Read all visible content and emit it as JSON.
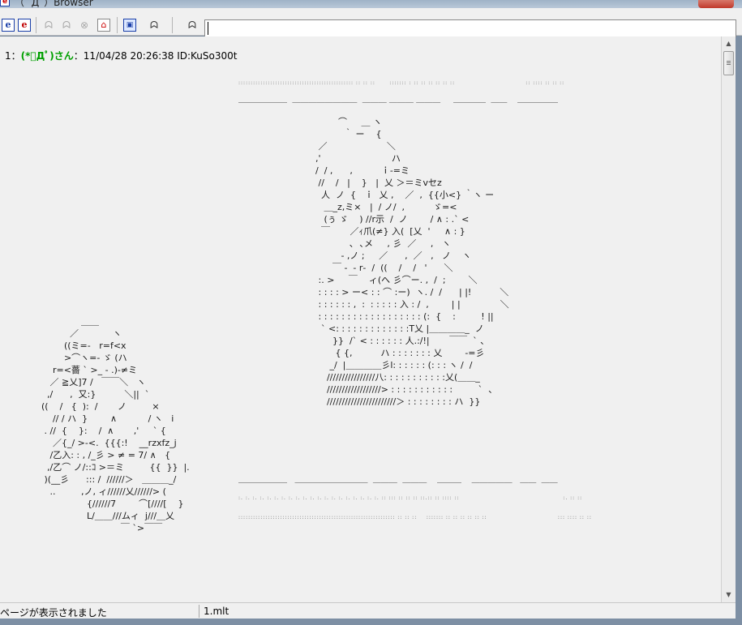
{
  "window": {
    "title": "（ ﾟДﾟ）Browser",
    "title_icon": "e"
  },
  "toolbar": {
    "buttons": [
      {
        "name": "ie-icon-1",
        "glyph": "e"
      },
      {
        "name": "ie-icon-2",
        "glyph": "e"
      },
      {
        "name": "back-disabled-icon",
        "glyph": "ᗣ"
      },
      {
        "name": "forward-disabled-icon",
        "glyph": "ᗣ"
      },
      {
        "name": "stop-disabled-icon",
        "glyph": "⊗"
      },
      {
        "name": "home-icon",
        "glyph": "⌂"
      },
      {
        "name": "window-icon",
        "glyph": "▣"
      },
      {
        "name": "mona-icon",
        "glyph": "ᗣ"
      },
      {
        "name": "settings-mona-icon",
        "glyph": "ᗣ"
      }
    ],
    "address_value": ""
  },
  "post": {
    "number": "1",
    "separator": "：",
    "name": "(*ﾟДﾟ)さん",
    "meta": "：11/04/28 20:26:38 ID:KuSo300t"
  },
  "art": {
    "dots_top_1": "::::::::::::::::::::::::::::::::::::::::::::::: :: :: ::      ::::::: : :: :: :: :: :: ::                              :: :::: :: :: ::",
    "dots_top_2": "＿＿＿＿＿＿  ＿＿＿＿＿＿＿＿  ＿＿＿ ＿＿＿ ＿＿＿     ＿＿＿＿  ＿＿    ＿＿＿＿＿",
    "right_figure": "          ⌒     ＿ ヽ\n            ｀ ー    {\n   ／                     ＼\n  ,'                         ハ\n  /  / ,      ,          ｉ‐=ミ\n   //    /   |    }   |  乂 ＞＝ミvセz\n    人  ノ  {   ｉ  乂 ,    ／  ,  {{小<} ｀ヽ ー\n     ＿_z,ミ×   |  / ノ/  ,          ゞ=<\n     (ぅ ゞ    ) //r示  /  ノ        / ∧ : .` <\n    ￣       ／ｨ爪(≠} 入(  [乂  '     ∧ : }\n              ､  ､メ     , 彡  ／     ,   ヽ\n           - ,ノ ;     ／      ,  ／   ,   ノ    ヽ\n        ￣ -  ‐ r‐  /  ((    /    /   '      ＼\n   :. >     ￣    ィ(へ 彡⌒ー. ,  /  ;        ＼\n   : : : : > ー< : : ⌒ :ー)  ヽ. /  /      | |!          ＼\n   : : : : : : ,  :  : : : : : 入 : /  ,        | |              ＼\n   : : : : : : : : : : : : : : : : : : (:  {    :         ! ||\n    ` <: : : : : : : : : : : : :T乂 |＿＿＿＿_  ノ\n        }}  /` < : : : : : : 人.:/!|       ￣￣  ` 、\n         { {,          ハ : : : : : : : 乂        ‐=彡\n       _/  |＿＿＿＿彡l: : : : : : (: : : ヽ /  /\n      ////////////////八: : : : : : : : : : :乂(＿＿_\n      //////////////////> : : : : : : : : : : :         `  、\n      ///////////////////////＞ : : : : : : : : ハ  }}",
    "left_figure": "                ＿＿\n            ／            ヽ\n          ((ミ=-   r=f<x\n          >⌒ヽ=- ゞ (ハ\n      r=<薔 ` >_ ‐ .)‐≠ミ\n     ／ ≧乂]7 /   ￣￣＼   ヽ\n    ,/      ,  又:}          ＼||  `\n  ((    /   {  ):  /       ノ         ×\n      // / ハ  }        ∧           / ヽ   i\n   . //  {    }:    /  ∧       ,'     ` {\n      ／{_/ >‐<.  {{{:!    __rzxfz_j\n     /乙入: : , /_彡 > ≠ = 7/ ∧   {\n    ,/乙⌒ ノ/::ｺ >＝ミ         {{  }}  |.\n   )(__彡      ::: /  //////＞   ＿＿＿_/\n     ..         ,ノ, ィ//////乂//////> (\n                  {//////7        ⌒[////[    }\n                  L/＿＿///ムィ  j///＿乂\n                              ￣ `>￣￣",
    "dots_bottom_1": "＿＿＿＿＿＿   ＿＿＿＿＿＿＿＿＿  ＿＿＿  ＿＿＿    ＿＿＿    ＿＿＿＿＿   ＿＿  ＿＿",
    "dots_bottom_2": ":. :. :. :. :. :. :. :. :. :. :. :. :. :. :. :. :. :. :. :. :: ::: :: :: :: ::.:: :: :::: ::                                            :. :: ::",
    "dots_bottom_3": ":::::::::::::::::::::::::::::::::::::::::::::::::::::::::::::::: :: :: ::    ::::::: :: :: :: :: :: ::                              ::: :::: :: ::"
  },
  "status": {
    "message": "ページが表示されました",
    "file": "1.mlt"
  },
  "colors": {
    "name_green": "#00a000",
    "content_bg": "#f0f0f0",
    "frame": "#6b7d93"
  }
}
